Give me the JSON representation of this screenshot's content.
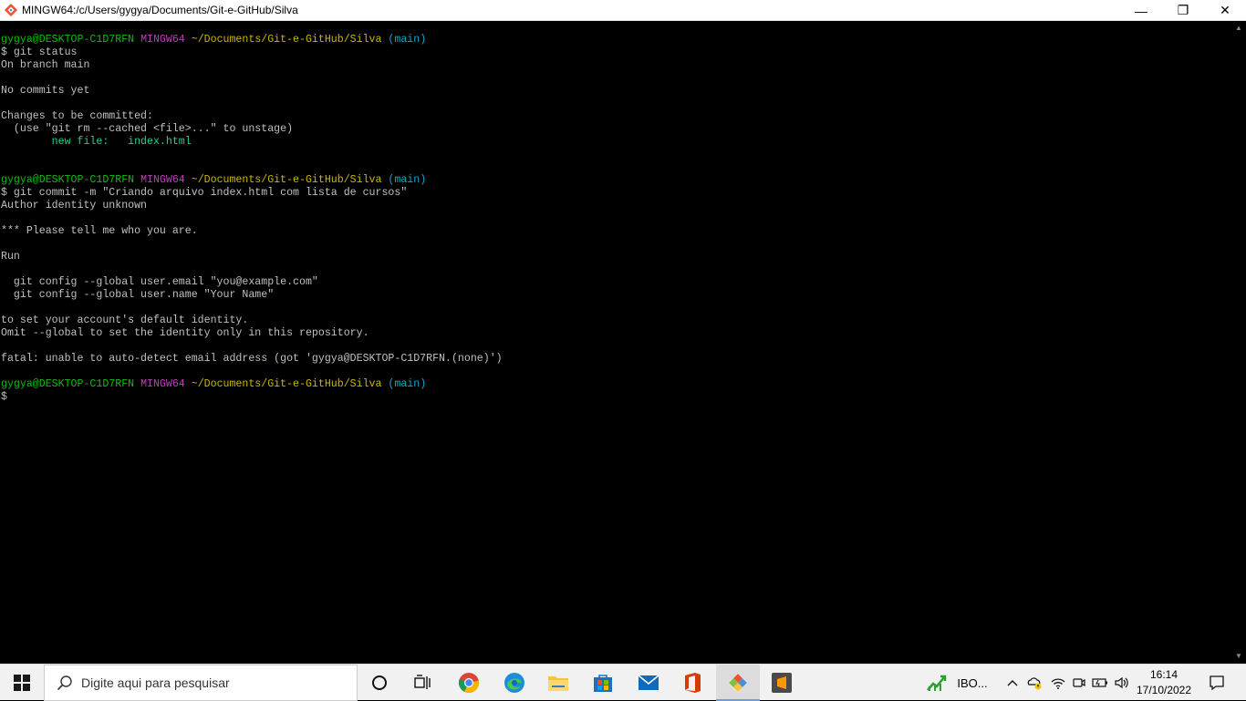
{
  "window": {
    "title": "MINGW64:/c/Users/gygya/Documents/Git-e-GitHub/Silva",
    "controls": {
      "minimize": "—",
      "maximize": "❐",
      "close": "✕"
    }
  },
  "terminal": {
    "lines": [
      [
        {
          "t": "gygya@DESKTOP-C1D7RFN ",
          "c": "c-green"
        },
        {
          "t": "MINGW64 ",
          "c": "c-magenta"
        },
        {
          "t": "~/Documents/Git-e-GitHub/Silva ",
          "c": "c-yellow"
        },
        {
          "t": "(main)",
          "c": "c-cyan"
        }
      ],
      [
        {
          "t": "$ git status",
          "c": ""
        }
      ],
      [
        {
          "t": "On branch main",
          "c": ""
        }
      ],
      [
        {
          "t": "",
          "c": ""
        }
      ],
      [
        {
          "t": "No commits yet",
          "c": ""
        }
      ],
      [
        {
          "t": "",
          "c": ""
        }
      ],
      [
        {
          "t": "Changes to be committed:",
          "c": ""
        }
      ],
      [
        {
          "t": "  (use \"git rm --cached <file>...\" to unstage)",
          "c": ""
        }
      ],
      [
        {
          "t": "        new file:   index.html",
          "c": "c-lg"
        }
      ],
      [
        {
          "t": "",
          "c": ""
        }
      ],
      [
        {
          "t": "",
          "c": ""
        }
      ],
      [
        {
          "t": "gygya@DESKTOP-C1D7RFN ",
          "c": "c-green"
        },
        {
          "t": "MINGW64 ",
          "c": "c-magenta"
        },
        {
          "t": "~/Documents/Git-e-GitHub/Silva ",
          "c": "c-yellow"
        },
        {
          "t": "(main)",
          "c": "c-cyan"
        }
      ],
      [
        {
          "t": "$ git commit -m \"Criando arquivo index.html com lista de cursos\"",
          "c": ""
        }
      ],
      [
        {
          "t": "Author identity unknown",
          "c": ""
        }
      ],
      [
        {
          "t": "",
          "c": ""
        }
      ],
      [
        {
          "t": "*** Please tell me who you are.",
          "c": ""
        }
      ],
      [
        {
          "t": "",
          "c": ""
        }
      ],
      [
        {
          "t": "Run",
          "c": ""
        }
      ],
      [
        {
          "t": "",
          "c": ""
        }
      ],
      [
        {
          "t": "  git config --global user.email \"you@example.com\"",
          "c": ""
        }
      ],
      [
        {
          "t": "  git config --global user.name \"Your Name\"",
          "c": ""
        }
      ],
      [
        {
          "t": "",
          "c": ""
        }
      ],
      [
        {
          "t": "to set your account's default identity.",
          "c": ""
        }
      ],
      [
        {
          "t": "Omit --global to set the identity only in this repository.",
          "c": ""
        }
      ],
      [
        {
          "t": "",
          "c": ""
        }
      ],
      [
        {
          "t": "fatal: unable to auto-detect email address (got 'gygya@DESKTOP-C1D7RFN.(none)')",
          "c": ""
        }
      ],
      [
        {
          "t": "",
          "c": ""
        }
      ],
      [
        {
          "t": "gygya@DESKTOP-C1D7RFN ",
          "c": "c-green"
        },
        {
          "t": "MINGW64 ",
          "c": "c-magenta"
        },
        {
          "t": "~/Documents/Git-e-GitHub/Silva ",
          "c": "c-yellow"
        },
        {
          "t": "(main)",
          "c": "c-cyan"
        }
      ],
      [
        {
          "t": "$",
          "c": ""
        }
      ]
    ]
  },
  "taskbar": {
    "search_placeholder": "Digite aqui para pesquisar",
    "apps": [
      "cortana-icon",
      "task-view-icon",
      "chrome-icon",
      "edge-icon",
      "file-explorer-icon",
      "store-icon",
      "mail-icon",
      "office-icon",
      "git-bash-icon",
      "sublime-text-icon"
    ],
    "tray_app_label": "IBO...",
    "clock_time": "16:14",
    "clock_date": "17/10/2022"
  },
  "colors": {
    "prompt_user": "#0dbc0d",
    "prompt_mingw": "#bc3fbc",
    "prompt_path": "#c9b600",
    "prompt_branch": "#11a8cd",
    "new_file": "#23d18b"
  }
}
